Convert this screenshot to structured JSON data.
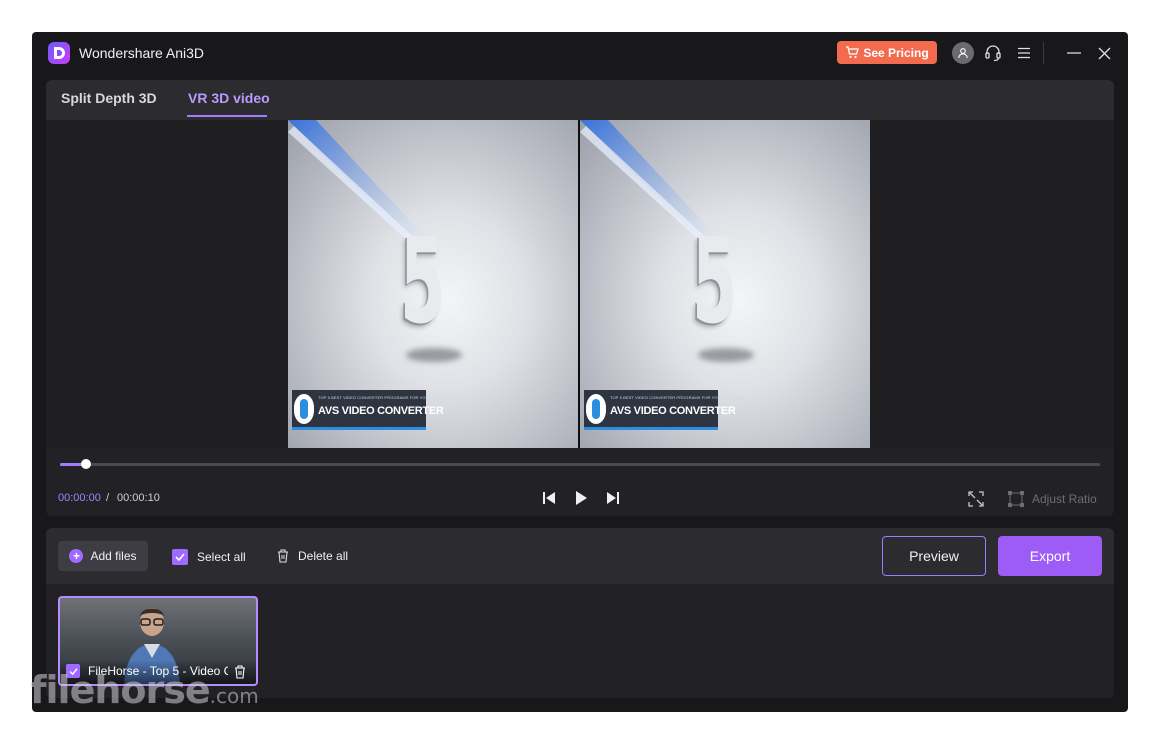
{
  "app": {
    "title": "Wondershare Ani3D",
    "pricing_label": "See Pricing"
  },
  "tabs": [
    {
      "label": "Split Depth 3D",
      "active": false
    },
    {
      "label": "VR 3D video",
      "active": true
    }
  ],
  "preview_frame": {
    "numeral": "5",
    "banner_small": "TOP 5 BEST VIDEO CONVERTER PROGRAMS FOR YOUR WINDOWS",
    "banner_title": "AVS VIDEO CONVERTER"
  },
  "player": {
    "time_current": "00:00:00",
    "time_separator": "/",
    "time_total": "00:00:10",
    "adjust_ratio_label": "Adjust Ratio",
    "progress": 0.02
  },
  "files_toolbar": {
    "add_files": "Add files",
    "select_all": "Select all",
    "delete_all": "Delete all",
    "preview": "Preview",
    "export": "Export"
  },
  "files": [
    {
      "name": "FileHorse - Top 5 - Video C",
      "selected": true
    }
  ],
  "watermark": {
    "brand": "filehorse",
    "tld": ".com"
  },
  "colors": {
    "accent": "#9d5cf5",
    "pricing": "#f26b4f",
    "background": "#18181b"
  }
}
